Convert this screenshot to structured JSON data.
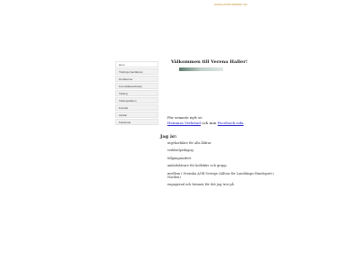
{
  "header": {
    "site_url": "www.verenahaller.se"
  },
  "nav": {
    "items": [
      {
        "label": "Hem"
      },
      {
        "label": "Tävlings-handlarare"
      },
      {
        "label": "Hundkurser"
      },
      {
        "label": "Konsultlärare/Inköp"
      },
      {
        "label": "Tävling"
      },
      {
        "label": "Tävlingsdatum"
      },
      {
        "label": "Kontakt"
      },
      {
        "label": "Länkar"
      },
      {
        "label": "Facebook"
      }
    ]
  },
  "main": {
    "title": "Välkommen till Verena Haller!",
    "visits_prefix": "För senaste nytt se",
    "link_start": "Hemmas Verkstad",
    "link_middle": "och min",
    "link_facebook": "Facebook sida",
    "section_heading": "Jag är:",
    "list_items": [
      "utgvkorkläre för alla åldrar",
      "veddzelpedagog",
      "tillgängmodert",
      "amlattslärare för kollektiv och grupp",
      "medlem i Svenska AGR Sverige (Alfons för Landskaps Hundsport i Norden)",
      "engagerad och brinner för det jag tror på"
    ]
  }
}
